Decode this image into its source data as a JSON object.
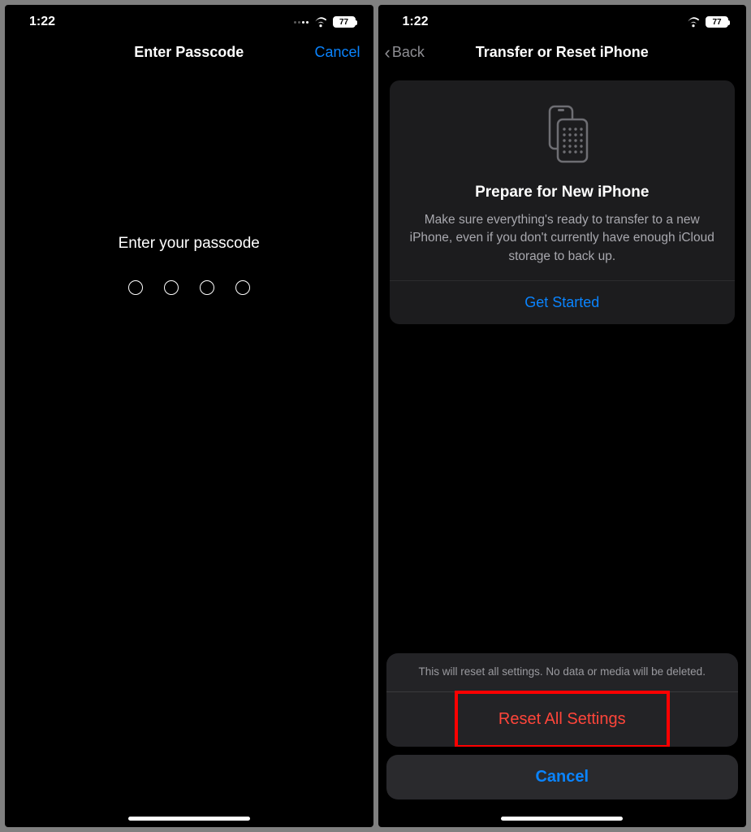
{
  "status": {
    "time": "1:22",
    "battery": "77"
  },
  "left": {
    "nav_title": "Enter Passcode",
    "cancel": "Cancel",
    "prompt": "Enter your passcode"
  },
  "right": {
    "back": "Back",
    "nav_title": "Transfer or Reset iPhone",
    "card": {
      "title": "Prepare for New iPhone",
      "desc": "Make sure everything's ready to transfer to a new iPhone, even if you don't currently have enough iCloud storage to back up.",
      "cta": "Get Started"
    },
    "sheet": {
      "message": "This will reset all settings. No data or media will be deleted.",
      "reset": "Reset All Settings",
      "cancel": "Cancel"
    }
  }
}
